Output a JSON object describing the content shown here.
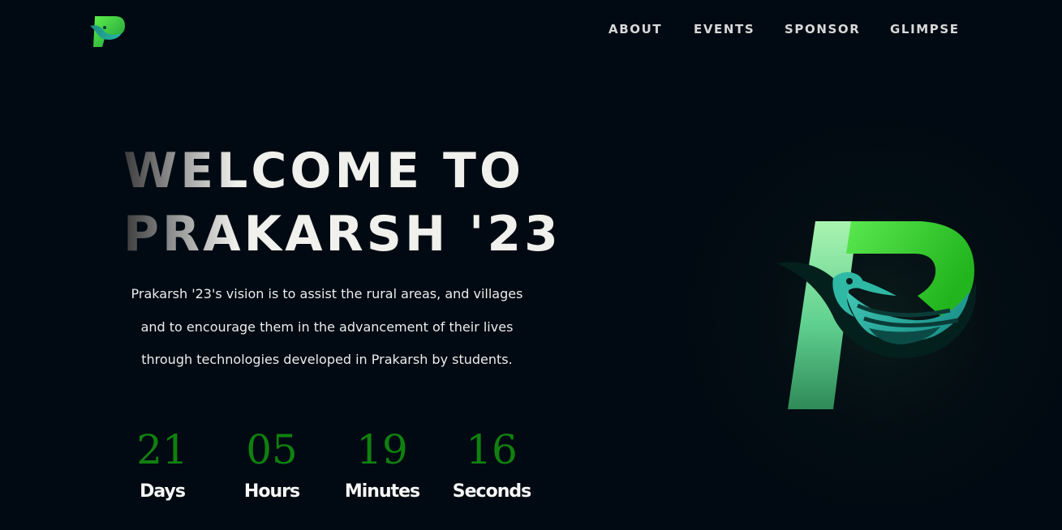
{
  "brand": {
    "logo_icon": "prakarsh-phoenix-logo-icon"
  },
  "nav": {
    "items": [
      {
        "label": "ABOUT"
      },
      {
        "label": "EVENTS"
      },
      {
        "label": "SPONSOR"
      },
      {
        "label": "GLIMPSE"
      }
    ]
  },
  "hero": {
    "headline_line1": "WELCOME TO",
    "headline_line2": "PRAKARSH '23",
    "description": "Prakarsh '23's vision is to assist the rural areas, and villages and to encourage them in the advancement of their lives through technologies developed in Prakarsh by students.",
    "logo_icon": "prakarsh-phoenix-logo-icon"
  },
  "countdown": {
    "units": [
      {
        "value": "21",
        "label": "Days"
      },
      {
        "value": "05",
        "label": "Hours"
      },
      {
        "value": "19",
        "label": "Minutes"
      },
      {
        "value": "16",
        "label": "Seconds"
      }
    ]
  },
  "colors": {
    "background": "#010a12",
    "accent_green": "#10800f",
    "logo_green": "#3fd92b",
    "logo_teal": "#1fa39a",
    "text": "#f3f3f3"
  }
}
